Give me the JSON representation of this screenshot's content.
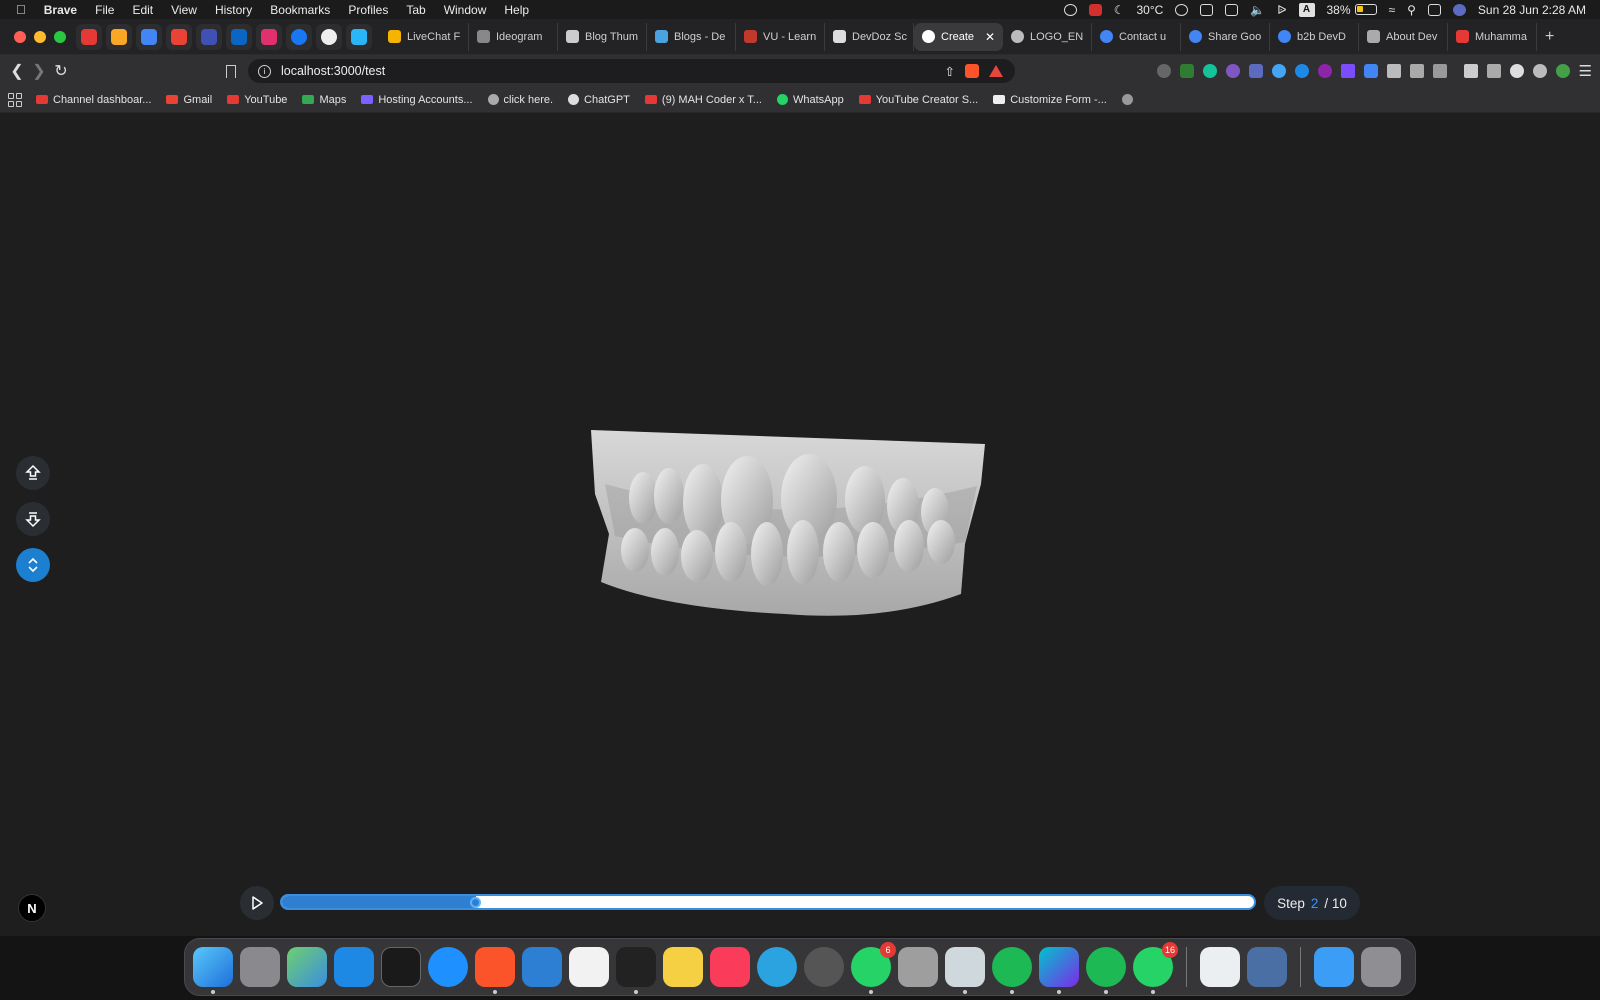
{
  "menubar": {
    "app": "Brave",
    "items": [
      "File",
      "Edit",
      "View",
      "History",
      "Bookmarks",
      "Profiles",
      "Tab",
      "Window",
      "Help"
    ],
    "temperature": "30°C",
    "battery": "38%",
    "battery_level": 0.38,
    "input_source": "A",
    "datetime": "Sun 28 Jun  2:28 AM"
  },
  "tabs": [
    {
      "label": "LiveChat F",
      "color": "#f5b400"
    },
    {
      "label": "Ideogram",
      "color": "#888888"
    },
    {
      "label": "Blog Thum",
      "color": "#cccccc"
    },
    {
      "label": "Blogs - De",
      "color": "#4aa3df"
    },
    {
      "label": "VU - Learn",
      "color": "#c0392b"
    },
    {
      "label": "DevDoz Sc",
      "color": "#dddddd"
    },
    {
      "label": "Create",
      "color": "#ffffff",
      "active": true
    },
    {
      "label": "LOGO_EN",
      "color": "#bbbbbb"
    },
    {
      "label": "Contact u",
      "color": "#4285f4"
    },
    {
      "label": "Share Goo",
      "color": "#4285f4"
    },
    {
      "label": "b2b DevD",
      "color": "#4285f4"
    },
    {
      "label": "About Dev",
      "color": "#aaaaaa"
    },
    {
      "label": "Muhamma",
      "color": "#e53935"
    }
  ],
  "address": {
    "url": "localhost:3000/test"
  },
  "bookmarks": [
    {
      "label": "Channel dashboar...",
      "color": "#e53935"
    },
    {
      "label": "Gmail",
      "color": "#ea4335"
    },
    {
      "label": "YouTube",
      "color": "#e53935"
    },
    {
      "label": "Maps",
      "color": "#34a853"
    },
    {
      "label": "Hosting Accounts...",
      "color": "#7b61ff"
    },
    {
      "label": "click here.",
      "color": "#aaaaaa"
    },
    {
      "label": "ChatGPT",
      "color": "#dddddd"
    },
    {
      "label": "(9) MAH Coder x T...",
      "color": "#e53935"
    },
    {
      "label": "WhatsApp",
      "color": "#25d366"
    },
    {
      "label": "YouTube Creator S...",
      "color": "#e53935"
    },
    {
      "label": "Customize Form -...",
      "color": "#eeeeee"
    }
  ],
  "viewer": {
    "n_badge": "N",
    "step_label": "Step",
    "step_current": "2",
    "step_total": "/ 10",
    "progress": 0.2,
    "accent": "#1d7fd0"
  },
  "dock": {
    "whatsapp_badge": "6",
    "whatsapp2_badge": "16"
  }
}
